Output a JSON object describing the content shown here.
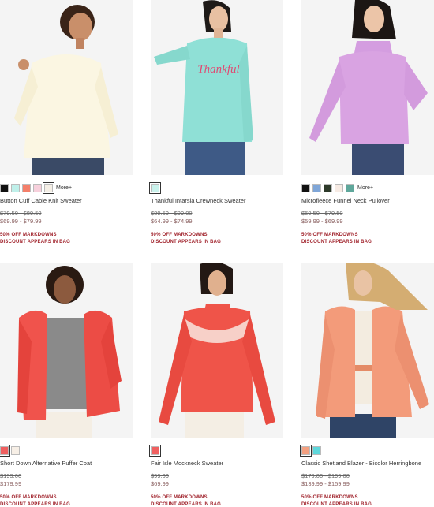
{
  "products": [
    {
      "name": "Button Cuff Cable Knit Sweater",
      "original_price": "$79.50 - $89.50",
      "sale_price": "$69.99 - $79.99",
      "promo_line1": "50% OFF MARKDOWNS",
      "promo_line2": "DISCOUNT APPEARS IN BAG",
      "more_label": "More+",
      "swatches": [
        "#111111",
        "#bff0ea",
        "#f47f6a",
        "#f7d0dc",
        "#f5efe6"
      ],
      "sweater_color": "#fbf6e2"
    },
    {
      "name": "Thankful Intarsia Crewneck Sweater",
      "original_price": "$89.50 - $99.00",
      "sale_price": "$64.99 - $74.99",
      "promo_line1": "50% OFF MARKDOWNS",
      "promo_line2": "DISCOUNT APPEARS IN BAG",
      "sweater_text": "Thankful",
      "swatches": [
        "#c9f2ec"
      ],
      "sweater_color": "#8fe0d6"
    },
    {
      "name": "Microfleece Funnel Neck Pullover",
      "original_price": "$69.50 - $79.50",
      "sale_price": "$59.99 - $69.99",
      "promo_line1": "50% OFF MARKDOWNS",
      "promo_line2": "DISCOUNT APPEARS IN BAG",
      "more_label": "More+",
      "swatches": [
        "#111111",
        "#7fa6d8",
        "#2d3a2a",
        "#f7ebe4",
        "#5fa79b"
      ],
      "sweater_color": "#d9a3e2"
    },
    {
      "name": "Short Down Alternative Puffer Coat",
      "original_price": "$199.00",
      "sale_price": "$179.99",
      "promo_line1": "50% OFF MARKDOWNS",
      "promo_line2": "DISCOUNT APPEARS IN BAG",
      "swatches": [
        "#f06060",
        "#f7efe6"
      ],
      "sweater_color": "#f0534c"
    },
    {
      "name": "Fair Isle Mockneck Sweater",
      "original_price": "$99.00",
      "sale_price": "$69.99",
      "promo_line1": "50% OFF MARKDOWNS",
      "promo_line2": "DISCOUNT APPEARS IN BAG",
      "swatches": [
        "#f06060"
      ],
      "sweater_color": "#ef5449"
    },
    {
      "name": "Classic Shetland Blazer - Bicolor Herringbone",
      "original_price": "$179.00 - $199.00",
      "sale_price": "$139.99 - $159.99",
      "promo_line1": "50% OFF MARKDOWNS",
      "promo_line2": "DISCOUNT APPEARS IN BAG",
      "swatches": [
        "#f4a080",
        "#5fd8dc"
      ],
      "sweater_color": "#f39b7a"
    }
  ]
}
